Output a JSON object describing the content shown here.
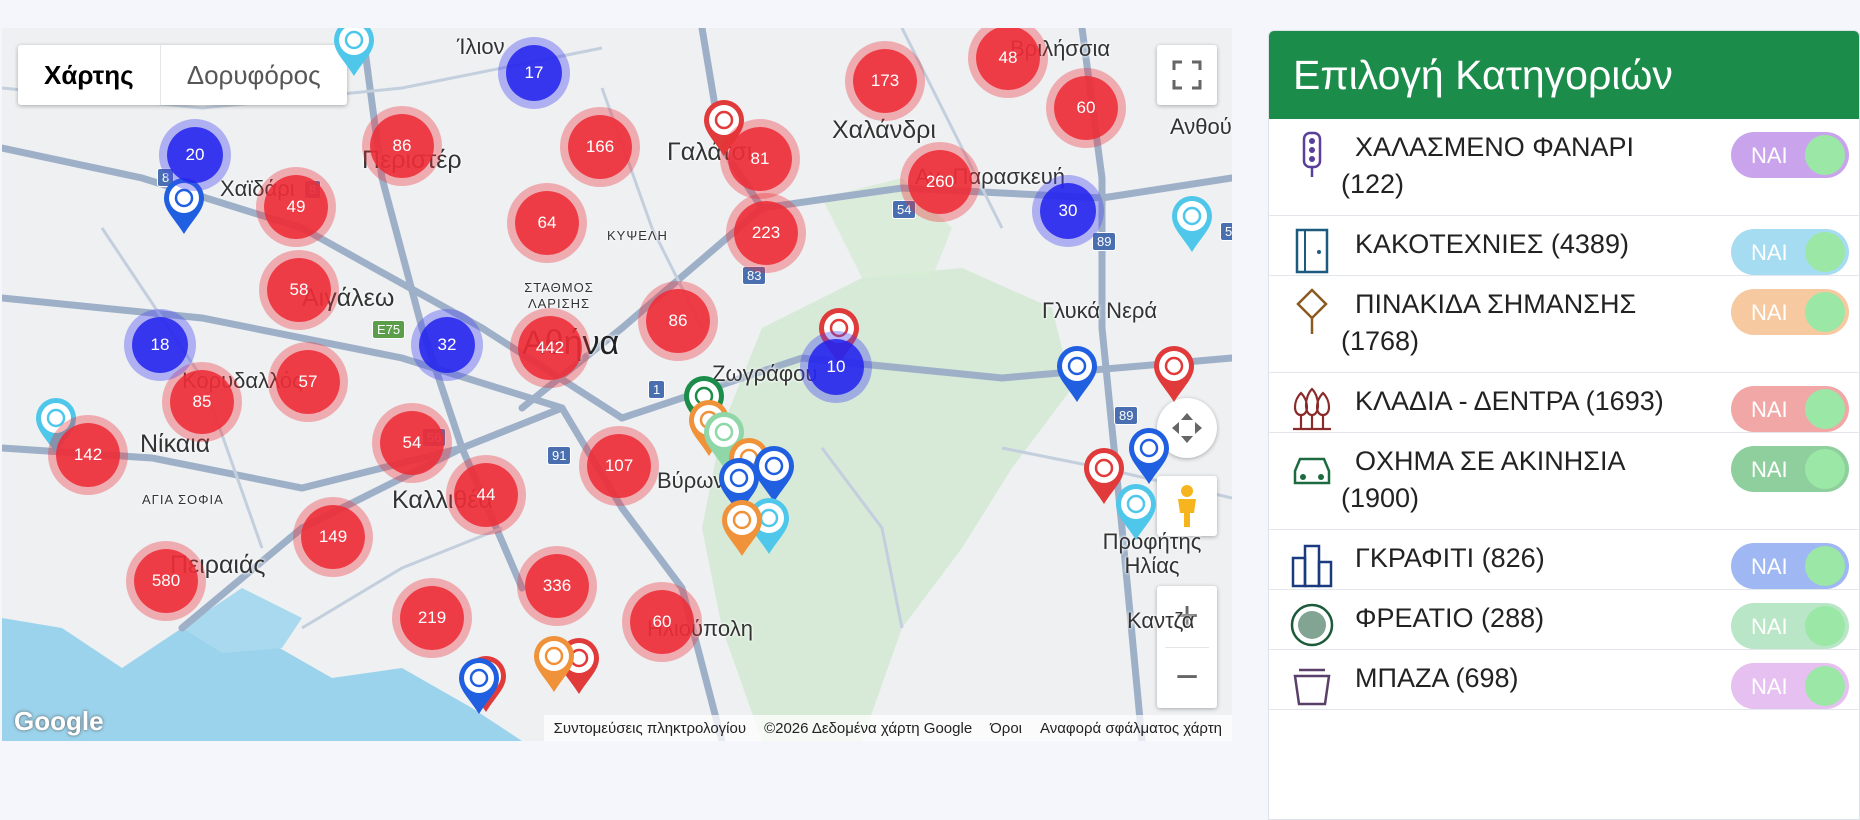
{
  "map": {
    "map_type_tabs": [
      "Χάρτης",
      "Δορυφόρος"
    ],
    "attribution": [
      "Συντομεύσεις πληκτρολογίου",
      "©2026 Δεδομένα χάρτη Google",
      "Όροι",
      "Αναφορά σφάλματος χάρτη"
    ],
    "logo": "Google",
    "zoom_in": "+",
    "zoom_out": "−",
    "places": [
      "Ίλιον",
      "Περιστέρ",
      "Χαϊδάρι",
      "Αιγάλεω",
      "Κορυδαλλός",
      "Νίκαια",
      "ΑΓΙΑ ΣΟΦΙΑ",
      "Πειραιάς",
      "Καλλιθέα",
      "Αθήνα",
      "ΣΤΑΘΜΟΣ ΛΑΡΙΣΗΣ",
      "ΚΥΨΕΛΗ",
      "Γαλάτσι",
      "Χαλάνδρι",
      "Αγ. Παρασκευή",
      "Βριλήσσια",
      "Ανθούσα",
      "Γλυκά Νερά",
      "Ζωγράφου",
      "Βύρωνας",
      "Ηλιούπολη",
      "Προφήτης Ηλίας",
      "Καντζα"
    ],
    "clusters_red": [
      "86",
      "166",
      "81",
      "173",
      "48",
      "60",
      "49",
      "64",
      "223",
      "260",
      "58",
      "86",
      "442",
      "57",
      "85",
      "142",
      "54",
      "107",
      "44",
      "149",
      "580",
      "336",
      "219",
      "60"
    ],
    "clusters_blue": [
      "17",
      "20",
      "32",
      "18",
      "10",
      "30"
    ],
    "road_shields": [
      "8",
      "8",
      "E75",
      "83",
      "54",
      "89",
      "1",
      "56",
      "91",
      "89",
      "5"
    ]
  },
  "panel": {
    "title": "Επιλογή Κατηγοριών",
    "toggle_label": "ΝΑΙ",
    "categories": [
      {
        "label": "ΧΑΛΑΣΜΕΝΟ ΦΑΝΑΡΙ (122)",
        "icon": "traffic-light-icon",
        "color": "#c9a4ec"
      },
      {
        "label": "ΚΑΚΟΤΕΧΝΙΕΣ (4389)",
        "icon": "door-icon",
        "color": "#a6dcf2"
      },
      {
        "label": "ΠΙΝΑΚΙΔΑ ΣΗΜΑΝΣΗΣ (1768)",
        "icon": "sign-icon",
        "color": "#f7c9a0"
      },
      {
        "label": "ΚΛΑΔΙΑ - ΔΕΝΤΡΑ (1693)",
        "icon": "trees-icon",
        "color": "#f2a7a7"
      },
      {
        "label": "ΟΧΗΜΑ ΣΕ ΑΚΙΝΗΣΙΑ (1900)",
        "icon": "car-icon",
        "color": "#8fcf9e"
      },
      {
        "label": "ΓΚΡΑΦΙΤΙ (826)",
        "icon": "buildings-icon",
        "color": "#9fb7f2"
      },
      {
        "label": "ΦΡΕΑΤΙΟ (288)",
        "icon": "manhole-icon",
        "color": "#b8e6c6"
      },
      {
        "label": "ΜΠΑΖΑ (698)",
        "icon": "bin-icon",
        "color": "#e6c0f0"
      }
    ]
  }
}
